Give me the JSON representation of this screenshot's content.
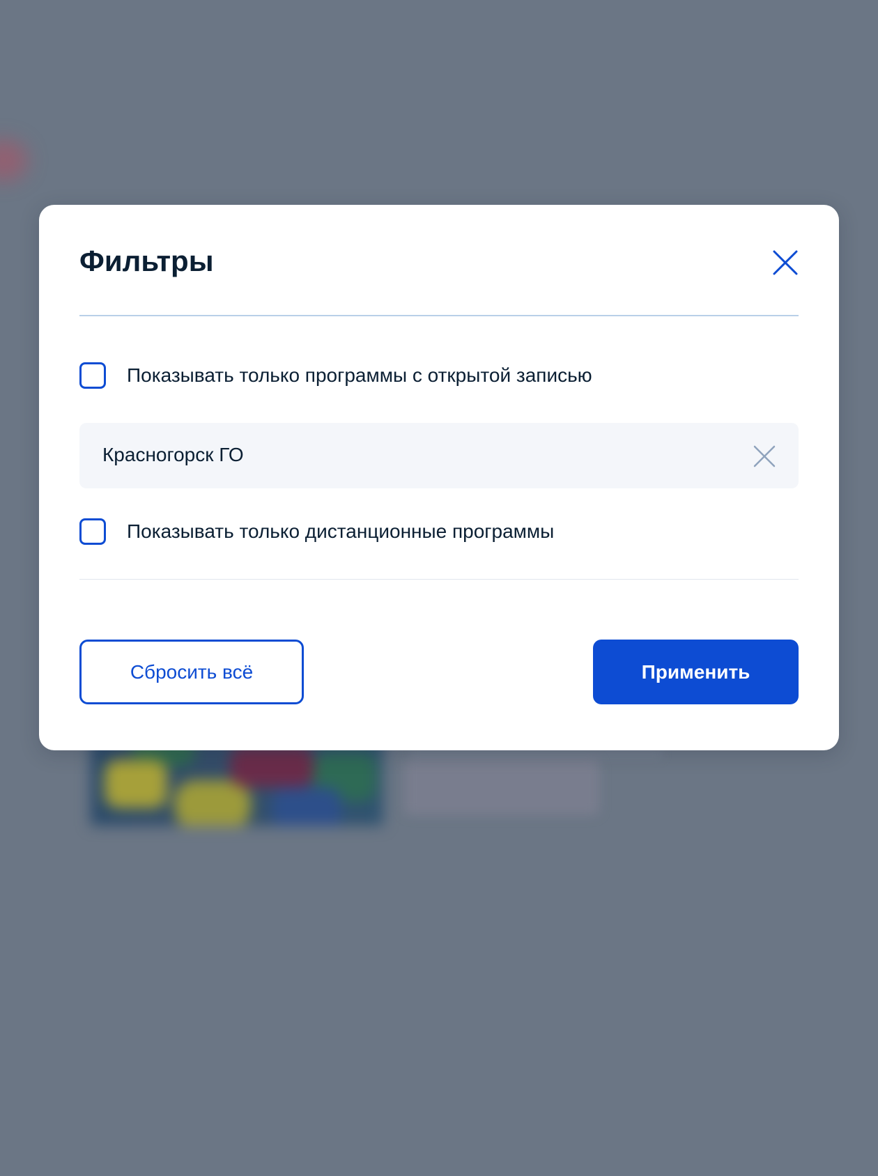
{
  "modal": {
    "title": "Фильтры",
    "close_icon": "close-icon"
  },
  "filters": {
    "open_enrollment_label": "Показывать только программы с открытой записью",
    "open_enrollment_checked": false,
    "location_value": "Красногорск ГО",
    "location_clear_icon": "clear-icon",
    "remote_only_label": "Показывать только дистанционные программы",
    "remote_only_checked": false
  },
  "actions": {
    "reset_label": "Сбросить всё",
    "apply_label": "Применить"
  },
  "colors": {
    "accent": "#0d4cd3",
    "overlay": "#6b7685",
    "text": "#0b1f33",
    "field_bg": "#f4f6fa"
  }
}
